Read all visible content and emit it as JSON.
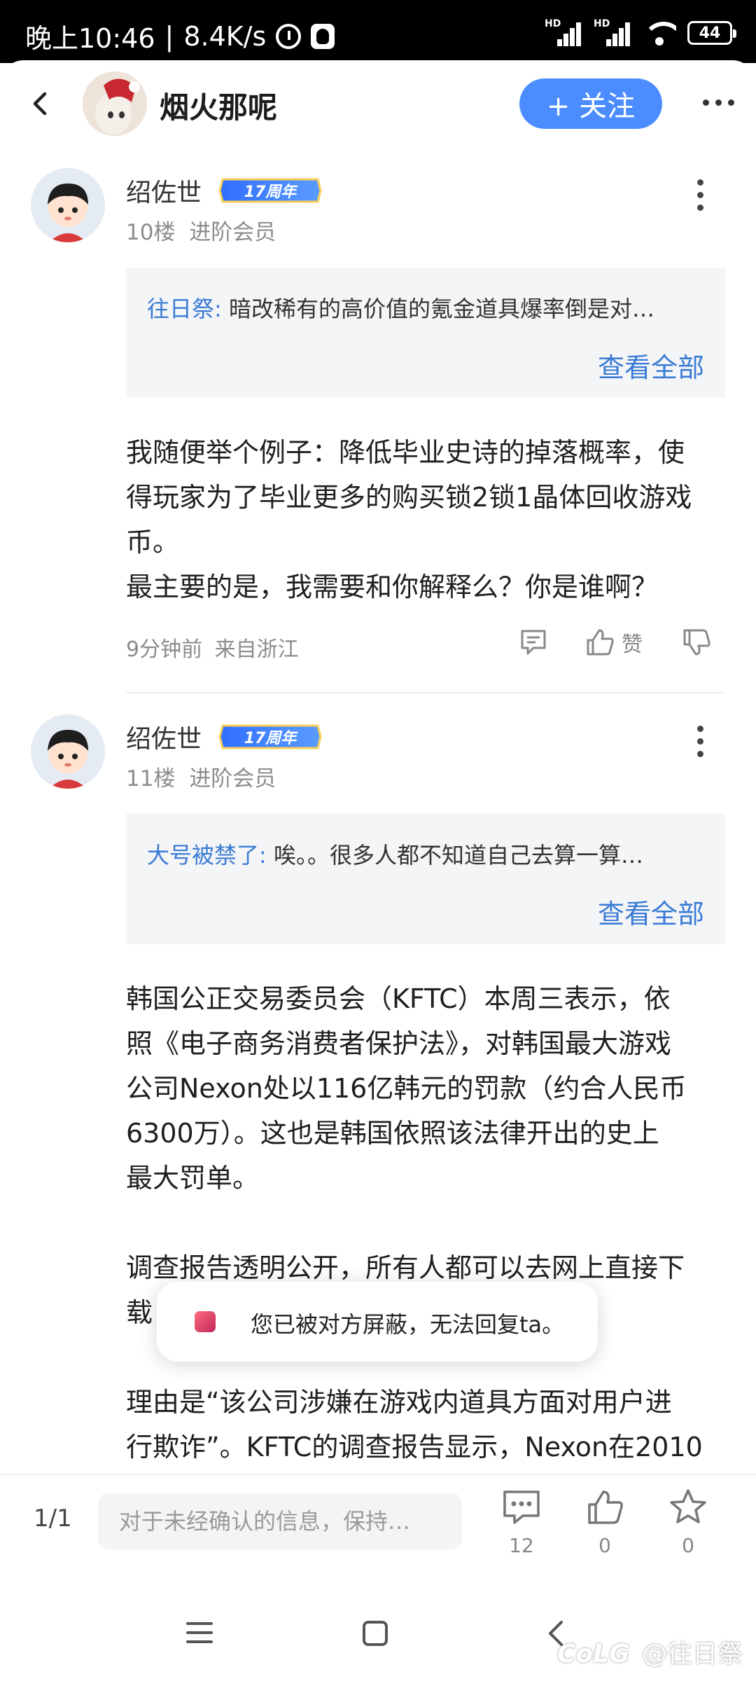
{
  "status_bar": {
    "time": "晚上10:46",
    "speed": "8.4K/s",
    "sim1": "HD",
    "sim2": "HD",
    "battery": "44"
  },
  "header": {
    "title": "烟火那呢",
    "follow_label": "+ 关注"
  },
  "posts": [
    {
      "username": "绍佐世",
      "badge": "17周年",
      "floor": "10楼",
      "level": "进阶会员",
      "quote_author": "往日祭:",
      "quote_text": " 暗改稀有的高价值的氪金道具爆率倒是对…",
      "quote_more": "查看全部",
      "lines": [
        "我随便举个例子：降低毕业史诗的掉落概率，使",
        "得玩家为了毕业更多的购买锁2锁1晶体回收游戏",
        "币。",
        "最主要的是，我需要和你解释么？你是谁啊？"
      ],
      "time": "9分钟前",
      "location": "来自浙江",
      "like_label": "赞"
    },
    {
      "username": "绍佐世",
      "badge": "17周年",
      "floor": "11楼",
      "level": "进阶会员",
      "quote_author": "大号被禁了:",
      "quote_text": " 唉。。很多人都不知道自己去算一算…",
      "quote_more": "查看全部",
      "lines": [
        "韩国公正交易委员会（KFTC）本周三表示，依",
        "照《电子商务消费者保护法》，对韩国最大游戏",
        "公司Nexon处以116亿韩元的罚款（约合人民币",
        "6300万）。这也是韩国依照该法律开出的史上",
        "最大罚单。",
        "",
        "调查报告透明公开，所有人都可以去网上直接下",
        "载",
        "",
        "理由是“该公司涉嫌在游戏内道具方面对用户进",
        "行欺诈”。KFTC的调查报告显示，Nexon在2010"
      ]
    }
  ],
  "toast": {
    "text": "您已被对方屏蔽，无法回复ta。"
  },
  "bottom_bar": {
    "pager": "1/1",
    "input_placeholder": "对于未经确认的信息，保持…",
    "comment_count": "12",
    "like_count": "0",
    "star_count": "0"
  },
  "watermark": {
    "logo": "CoLG",
    "text": "@往日祭"
  },
  "colors": {
    "accent": "#4b8dff",
    "link": "#3a7bd5",
    "quote_bg": "#f4f5f7"
  }
}
